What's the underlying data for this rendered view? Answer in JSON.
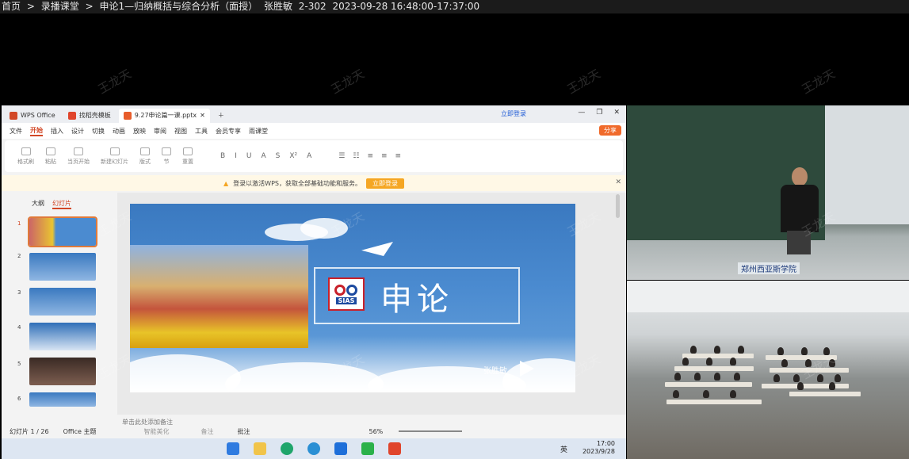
{
  "breadcrumb": {
    "home": "首页",
    "sep": ">",
    "section": "录播课堂",
    "course": "申论1—归纳概括与综合分析（面授）",
    "teacher": "张胜敏",
    "room": "2-302",
    "time": "2023-09-28 16:48:00-17:37:00"
  },
  "watermark": "王龙天",
  "wps": {
    "tabs": [
      {
        "label": "WPS Office",
        "color": "#d24726"
      },
      {
        "label": "找稻壳模板",
        "color": "#e0452c"
      },
      {
        "label": "9.27申论篇一课.pptx",
        "color": "#e85d2b"
      }
    ],
    "login": "立即登录",
    "menu": [
      "文件",
      "开始",
      "插入",
      "设计",
      "切换",
      "动画",
      "放映",
      "审阅",
      "视图",
      "工具",
      "会员专享",
      "雨课堂"
    ],
    "active_menu": "开始",
    "share": "分享",
    "tools": [
      "格式刷",
      "粘贴",
      "当页开始",
      "新建幻灯片",
      "版式",
      "节",
      "重置"
    ],
    "notice": {
      "text": "登录以激活WPS，获取全部基础功能和服务。",
      "button": "立即登录"
    },
    "left_tabs": {
      "outline": "大纲",
      "slides": "幻灯片"
    },
    "slide_numbers": [
      "1",
      "2",
      "3",
      "4",
      "5",
      "6"
    ],
    "slide": {
      "title": "申论",
      "logo_text": "SIAS",
      "author": "张胜敏"
    },
    "notes_placeholder": "单击此处添加备注",
    "status": {
      "slide_count": "幻灯片 1 / 26",
      "theme": "Office 主题",
      "smart": "智能美化",
      "notes": "备注",
      "comments": "批注",
      "zoom": "56%"
    },
    "taskbar": {
      "ime": "英",
      "time": "17:00",
      "date": "2023/9/28"
    }
  },
  "camera": {
    "sign": "郑州西亚斯学院"
  },
  "colors": {
    "accent": "#d24726",
    "share": "#f06a2b",
    "slide_blue": "#3a79c0"
  }
}
